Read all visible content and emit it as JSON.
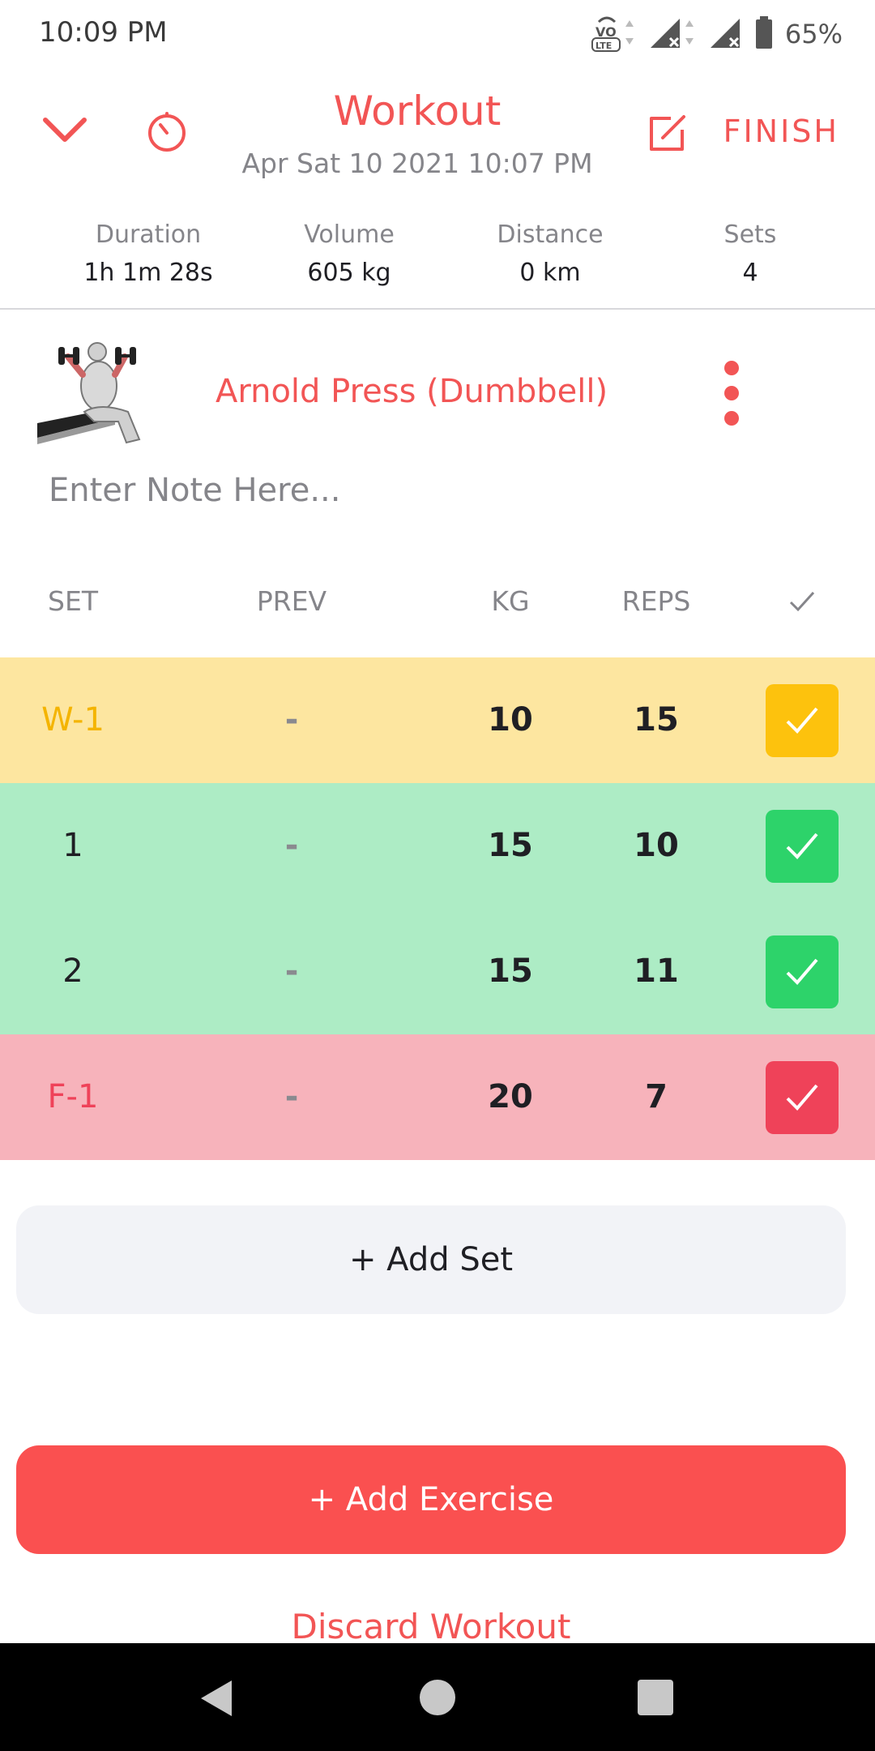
{
  "status_bar": {
    "time": "10:09 PM",
    "battery": "65%",
    "icons": [
      "volte-icon",
      "signal-icon",
      "signal-icon",
      "battery-icon"
    ]
  },
  "header": {
    "title": "Workout",
    "subtitle": "Apr Sat 10 2021 10:07 PM",
    "finish_label": "FINISH",
    "icons": [
      "chevron-down-icon",
      "timer-icon",
      "edit-icon"
    ]
  },
  "stats": [
    {
      "label": "Duration",
      "value": "1h 1m 28s"
    },
    {
      "label": "Volume",
      "value": "605 kg"
    },
    {
      "label": "Distance",
      "value": "0 km"
    },
    {
      "label": "Sets",
      "value": "4"
    }
  ],
  "exercise": {
    "name": "Arnold Press (Dumbbell)",
    "note_placeholder": "Enter Note Here..."
  },
  "table": {
    "columns": [
      "SET",
      "PREV",
      "KG",
      "REPS"
    ],
    "rows": [
      {
        "set": "W-1",
        "prev": "-",
        "kg": "10",
        "reps": "15",
        "type": "warmup",
        "done": true
      },
      {
        "set": "1",
        "prev": "-",
        "kg": "15",
        "reps": "10",
        "type": "normal",
        "done": true
      },
      {
        "set": "2",
        "prev": "-",
        "kg": "15",
        "reps": "11",
        "type": "normal",
        "done": true
      },
      {
        "set": "F-1",
        "prev": "-",
        "kg": "20",
        "reps": "7",
        "type": "failure",
        "done": true
      }
    ]
  },
  "actions": {
    "add_set": "+ Add Set",
    "add_exercise": "+ Add Exercise",
    "discard": "Discard Workout"
  },
  "colors": {
    "accent": "#f25555",
    "warmup_bg": "#fde6a0",
    "warmup_check": "#fdc20d",
    "warmup_text": "#f4b400",
    "normal_bg": "#adecc5",
    "normal_check": "#2dd36a",
    "failure_bg": "#f7b3bb",
    "failure_check": "#ef4259",
    "failure_text": "#ef4259"
  },
  "navbar": {
    "icons": [
      "back-icon",
      "home-icon",
      "recents-icon"
    ]
  }
}
